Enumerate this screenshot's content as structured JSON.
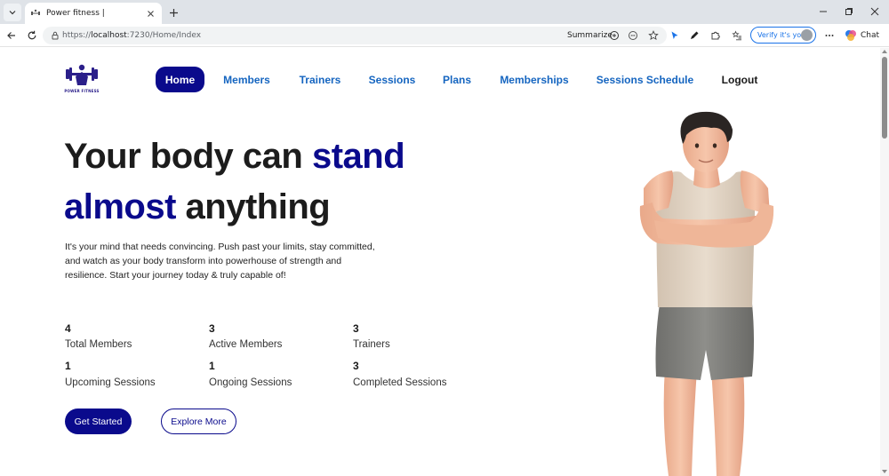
{
  "browser": {
    "tab_title": "Power fitness |",
    "url_scheme": "https://",
    "url_host": "localhost",
    "url_rest": ":7230/Home/Index",
    "summarize_label": "Summarize",
    "verify_label": "Verify it's you",
    "chat_label": "Chat"
  },
  "brand": {
    "logo_text": "POWER FITNESS",
    "primary_color": "#0a0a8c",
    "link_color": "#1565c0"
  },
  "nav": {
    "home": "Home",
    "members": "Members",
    "trainers": "Trainers",
    "sessions": "Sessions",
    "plans": "Plans",
    "memberships": "Memberships",
    "schedule": "Sessions Schedule",
    "logout": "Logout"
  },
  "hero": {
    "line1_a": "Your body can ",
    "line1_b": "stand",
    "line2_a": "almost",
    "line2_b": " anything",
    "description": "It's your mind that needs convincing. Push past your limits, stay committed, and watch as your body transform into powerhouse of strength and resilience. Start your journey today & truly capable of!"
  },
  "stats": [
    {
      "value": "4",
      "label": "Total Members"
    },
    {
      "value": "3",
      "label": "Active Members"
    },
    {
      "value": "3",
      "label": "Trainers"
    },
    {
      "value": "1",
      "label": "Upcoming Sessions"
    },
    {
      "value": "1",
      "label": "Ongoing Sessions"
    },
    {
      "value": "3",
      "label": "Completed Sessions"
    }
  ],
  "actions": {
    "get_started": "Get Started",
    "explore_more": "Explore More"
  }
}
